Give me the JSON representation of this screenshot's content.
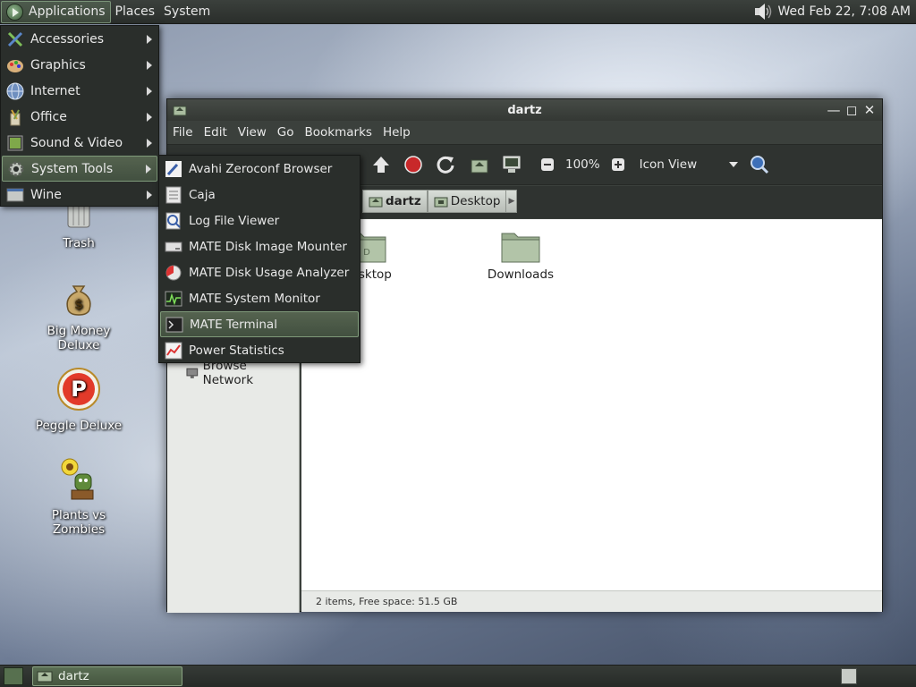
{
  "top_panel": {
    "menus": [
      "Applications",
      "Places",
      "System"
    ],
    "clock": "Wed Feb 22,  7:08 AM"
  },
  "desktop": {
    "icons": [
      {
        "label": "Trash"
      },
      {
        "label": "Big Money Deluxe"
      },
      {
        "label": "Peggle Deluxe"
      },
      {
        "label": "Plants vs Zombies"
      }
    ]
  },
  "applications_menu": {
    "items": [
      "Accessories",
      "Graphics",
      "Internet",
      "Office",
      "Sound & Video",
      "System Tools",
      "Wine"
    ],
    "highlighted": "System Tools"
  },
  "system_tools_menu": {
    "items": [
      "Avahi Zeroconf Browser",
      "Caja",
      "Log File Viewer",
      "MATE Disk Image Mounter",
      "MATE Disk Usage Analyzer",
      "MATE System Monitor",
      "MATE Terminal",
      "Power Statistics"
    ],
    "highlighted": "MATE Terminal"
  },
  "window": {
    "title": "dartz",
    "menubar": [
      "File",
      "Edit",
      "View",
      "Go",
      "Bookmarks",
      "Help"
    ],
    "toolbar": {
      "zoom": "100%",
      "view_mode": "Icon View"
    },
    "breadcrumbs": [
      "dartz",
      "Desktop"
    ],
    "sidebar": {
      "browse_network": "Browse Network"
    },
    "files": [
      "Desktop",
      "Downloads"
    ],
    "status": "2 items, Free space: 51.5 GB"
  },
  "taskbar": {
    "task": "dartz"
  },
  "colors": {
    "panel": "#2a2e2b",
    "highlight": "#55634f",
    "folder": "#9aae8f"
  }
}
